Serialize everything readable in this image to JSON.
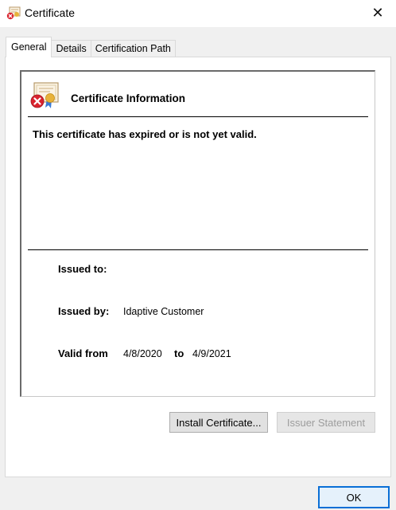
{
  "window": {
    "title": "Certificate",
    "title_icon": "certificate-error-icon",
    "close_glyph": "✕"
  },
  "tabs": [
    {
      "label": "General",
      "active": true
    },
    {
      "label": "Details",
      "active": false
    },
    {
      "label": "Certification Path",
      "active": false
    }
  ],
  "info": {
    "heading": "Certificate Information",
    "status_message": "This certificate has expired or is not yet valid.",
    "issued_to_label": "Issued to:",
    "issued_to_value": "",
    "issued_by_label": "Issued by:",
    "issued_by_value": "Idaptive Customer",
    "valid_from_label": "Valid from",
    "valid_from_value": "4/8/2020",
    "valid_to_label": "to",
    "valid_to_value": "4/9/2021"
  },
  "buttons": {
    "install_certificate": "Install Certificate...",
    "issuer_statement": "Issuer Statement",
    "ok": "OK"
  },
  "colors": {
    "ok_border": "#0a6fd6",
    "disabled_text": "#9d9d9d",
    "error_red": "#d9232e",
    "seal_gold": "#e8b23a"
  }
}
